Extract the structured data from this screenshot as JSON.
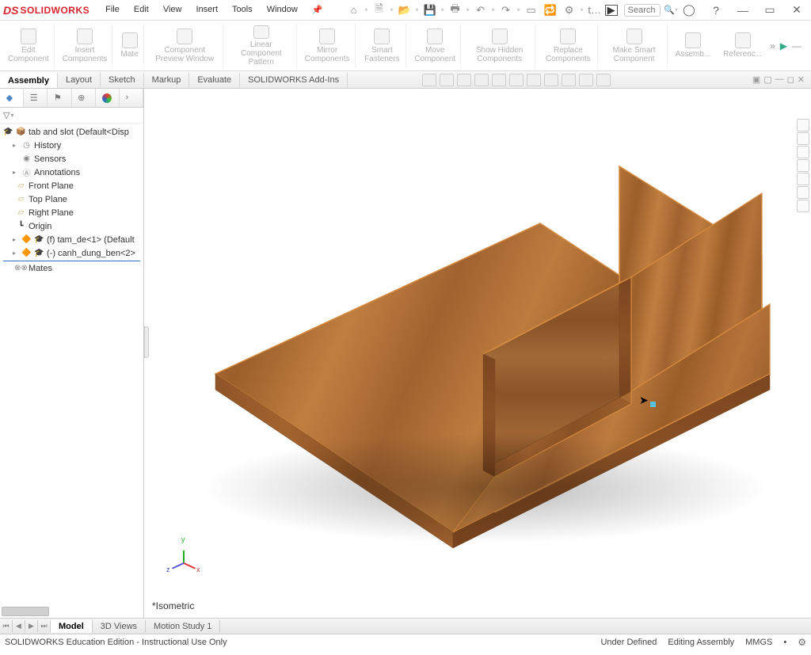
{
  "app": {
    "logo_prefix": "DS",
    "logo_text": "SOLIDWORKS"
  },
  "menu": [
    "File",
    "Edit",
    "View",
    "Insert",
    "Tools",
    "Window"
  ],
  "search_placeholder": "Search Commands",
  "ribbon": {
    "groups": [
      {
        "label": "Edit\nComponent"
      },
      {
        "label": "Insert Components"
      },
      {
        "label": "Mate"
      },
      {
        "label": "Component\nPreview Window"
      },
      {
        "label": "Linear Component Pattern"
      },
      {
        "label": "Mirror\nComponents"
      },
      {
        "label": "Smart\nFasteners"
      },
      {
        "label": "Move Component"
      },
      {
        "label": "Show Hidden\nComponents"
      },
      {
        "label": "Replace\nComponents"
      },
      {
        "label": "Make Smart\nComponent"
      },
      {
        "label": "Assemb..."
      },
      {
        "label": "Referenc..."
      }
    ]
  },
  "tabs": [
    "Assembly",
    "Layout",
    "Sketch",
    "Markup",
    "Evaluate",
    "SOLIDWORKS Add-Ins"
  ],
  "active_tab": "Assembly",
  "tree": {
    "root": "tab and slot  (Default<Disp",
    "items": [
      {
        "label": "History",
        "icon": "history"
      },
      {
        "label": "Sensors",
        "icon": "sensor"
      },
      {
        "label": "Annotations",
        "icon": "annotation",
        "exp": true
      },
      {
        "label": "Front Plane",
        "icon": "plane"
      },
      {
        "label": "Top Plane",
        "icon": "plane"
      },
      {
        "label": "Right Plane",
        "icon": "plane"
      },
      {
        "label": "Origin",
        "icon": "origin"
      },
      {
        "label": "(f) tam_de<1> (Default",
        "icon": "part",
        "exp": true,
        "fixed": true
      },
      {
        "label": "(-) canh_dung_ben<2>",
        "icon": "part",
        "exp": true,
        "under": true
      },
      {
        "label": "Mates",
        "icon": "mates"
      }
    ]
  },
  "view_label": "*Isometric",
  "triad": {
    "x": "x",
    "y": "y",
    "z": "z"
  },
  "bottom_tabs": [
    "Model",
    "3D Views",
    "Motion Study 1"
  ],
  "active_bottom_tab": "Model",
  "status": {
    "left": "SOLIDWORKS Education Edition - Instructional Use Only",
    "defined": "Under Defined",
    "mode": "Editing Assembly",
    "units": "MMGS"
  }
}
